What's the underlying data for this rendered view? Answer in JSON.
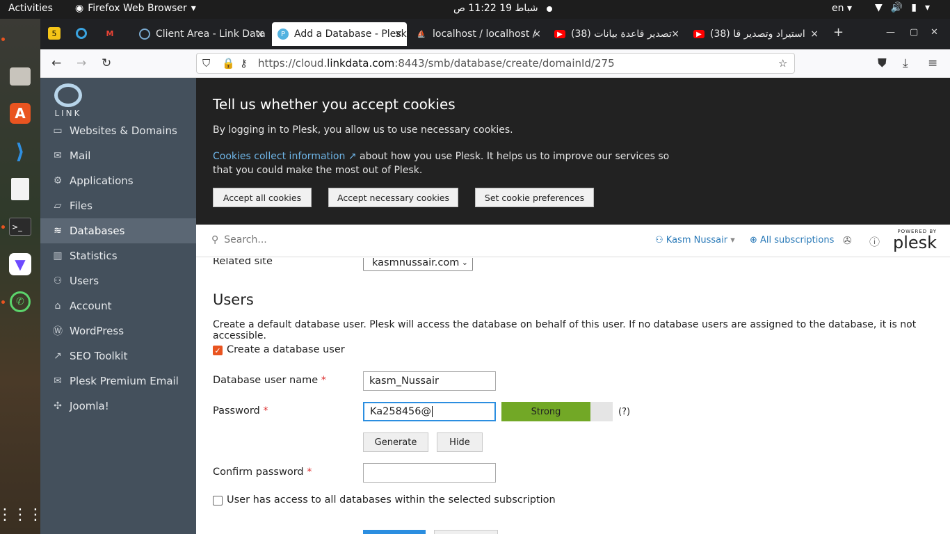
{
  "system_bar": {
    "activities": "Activities",
    "app_name": "Firefox Web Browser",
    "clock": "شباط 19  11:22 ص",
    "language": "en"
  },
  "dock": {
    "apps": [
      "firefox-icon",
      "files-icon",
      "software-icon",
      "vscode-icon",
      "document-viewer-icon",
      "terminal-icon",
      "protonvpn-icon",
      "whatsapp-icon",
      "app-grid-icon"
    ]
  },
  "tabs": {
    "pinned": [
      "5",
      "",
      "M"
    ],
    "items": [
      {
        "label": "Client Area - Link Data",
        "close": "×"
      },
      {
        "label": "Add a Database - Plesk",
        "close": "×"
      },
      {
        "label": "localhost / localhost / ",
        "close": "×"
      },
      {
        "label": "(38) تصدير قاعدة بيانات",
        "close": "×"
      },
      {
        "label": "(38) استيراد وتصدير قا",
        "close": "×"
      }
    ],
    "new_tab": "+"
  },
  "navbar": {
    "url_prefix": "https://cloud.",
    "url_domain": "linkdata.com",
    "url_suffix": ":8443/smb/database/create/domainId/275"
  },
  "sidebar": {
    "logo_text": "LINK",
    "items": [
      {
        "label": "Websites & Domains",
        "icon": "monitor-icon"
      },
      {
        "label": "Mail",
        "icon": "mail-icon"
      },
      {
        "label": "Applications",
        "icon": "gear-icon"
      },
      {
        "label": "Files",
        "icon": "folder-icon"
      },
      {
        "label": "Databases",
        "icon": "database-icon"
      },
      {
        "label": "Statistics",
        "icon": "chart-icon"
      },
      {
        "label": "Users",
        "icon": "user-icon"
      },
      {
        "label": "Account",
        "icon": "account-icon"
      },
      {
        "label": "WordPress",
        "icon": "wordpress-icon"
      },
      {
        "label": "SEO Toolkit",
        "icon": "seo-icon"
      },
      {
        "label": "Plesk Premium Email",
        "icon": "email-icon"
      },
      {
        "label": "Joomla!",
        "icon": "joomla-icon"
      }
    ],
    "active_index": 4
  },
  "cookie_banner": {
    "title": "Tell us whether you accept cookies",
    "line1": "By logging in to Plesk, you allow us to use necessary cookies.",
    "link": "Cookies collect information",
    "line2": "about how you use Plesk. It helps us to improve our services so that you could make the most out of Plesk.",
    "btn_accept_all": "Accept all cookies",
    "btn_accept_necessary": "Accept necessary cookies",
    "btn_preferences": "Set cookie preferences"
  },
  "header": {
    "search_placeholder": "Search...",
    "user": "Kasm Nussair",
    "subscriptions": "All subscriptions",
    "powered_by": "POWERED BY",
    "brand": "plesk"
  },
  "form": {
    "related_site_label": "Related site",
    "related_site_value": "kasmnussair.com",
    "users_heading": "Users",
    "users_desc": "Create a default database user. Plesk will access the database on behalf of this user. If no database users are assigned to the database, it is not accessible.",
    "create_user_label": "Create a database user",
    "create_user_checked": true,
    "username_label": "Database user name",
    "username_value": "kasm_Nussair",
    "password_label": "Password",
    "password_value": "Ka258456@",
    "strength_label": "Strong",
    "strength_fraction": 0.8,
    "help": "(?)",
    "generate": "Generate",
    "hide": "Hide",
    "confirm_label": "Confirm password",
    "confirm_value": "",
    "all_db_label": "User has access to all databases within the selected subscription",
    "all_db_checked": false,
    "required_mark": "*"
  }
}
